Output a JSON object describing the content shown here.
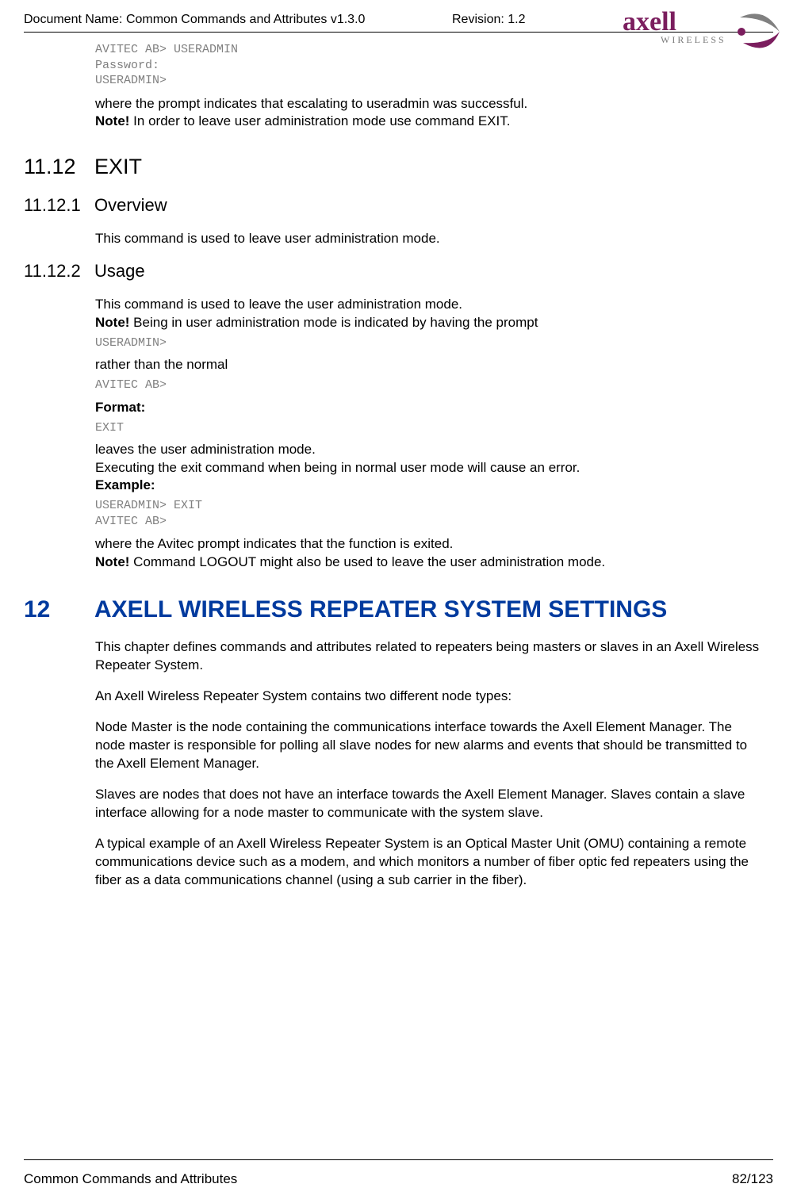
{
  "header": {
    "document_name_label": "Document Name: Common Commands and Attributes v1.3.0",
    "revision_label": "Revision: 1.2",
    "brand": {
      "name": "axell",
      "sub": "WIRELESS"
    }
  },
  "intro": {
    "code_block": "AVITEC AB> USERADMIN\nPassword:\nUSERADMIN>",
    "line1": "where the prompt indicates that escalating to useradmin was successful.",
    "note_label": "Note!",
    "note_text": " In order to leave user administration mode use command EXIT."
  },
  "sec_exit": {
    "num": "11.12",
    "title": "EXIT"
  },
  "sec_overview": {
    "num": "11.12.1",
    "title": "Overview",
    "body": "This command is used to leave user administration mode."
  },
  "sec_usage": {
    "num": "11.12.2",
    "title": "Usage",
    "p1": "This command is used to leave the user administration mode.",
    "note_label": "Note!",
    "note_text": " Being in user administration mode is indicated by having the prompt",
    "code1": "USERADMIN>",
    "p2": "rather than the normal",
    "code2": "AVITEC AB>",
    "format_label": "Format:",
    "code3": "EXIT",
    "p3a": "leaves the user administration mode.",
    "p3b": "Executing the exit command when being in normal user mode will cause an error.",
    "example_label": "Example:",
    "code4": "USERADMIN> EXIT\nAVITEC AB>",
    "p4": "where the Avitec prompt indicates that the function is exited.",
    "note2_label": "Note!",
    "note2_text": " Command LOGOUT might also be used to leave the user administration mode."
  },
  "chapter12": {
    "num": "12",
    "title": "AXELL WIRELESS REPEATER SYSTEM SETTINGS",
    "p1": "This chapter defines commands and attributes related to repeaters being masters or slaves in an Axell Wireless Repeater System.",
    "p2": "An Axell Wireless Repeater System contains two different node types:",
    "p3": "Node Master is the node containing the communications interface towards the Axell Element Manager. The node master is responsible for polling all slave nodes for new alarms and events that should be transmitted to the Axell Element Manager.",
    "p4": "Slaves are nodes that does not have an interface towards the Axell Element Manager. Slaves contain a slave interface allowing for a node master to communicate with the system slave.",
    "p5": "A typical example of an Axell Wireless Repeater System is an Optical Master Unit (OMU) containing a remote communications device such as a modem, and which monitors a number of fiber optic fed repeaters using the fiber as a data communications channel (using a sub carrier in the fiber)."
  },
  "footer": {
    "left": "Common Commands and Attributes",
    "right": "82/123"
  }
}
